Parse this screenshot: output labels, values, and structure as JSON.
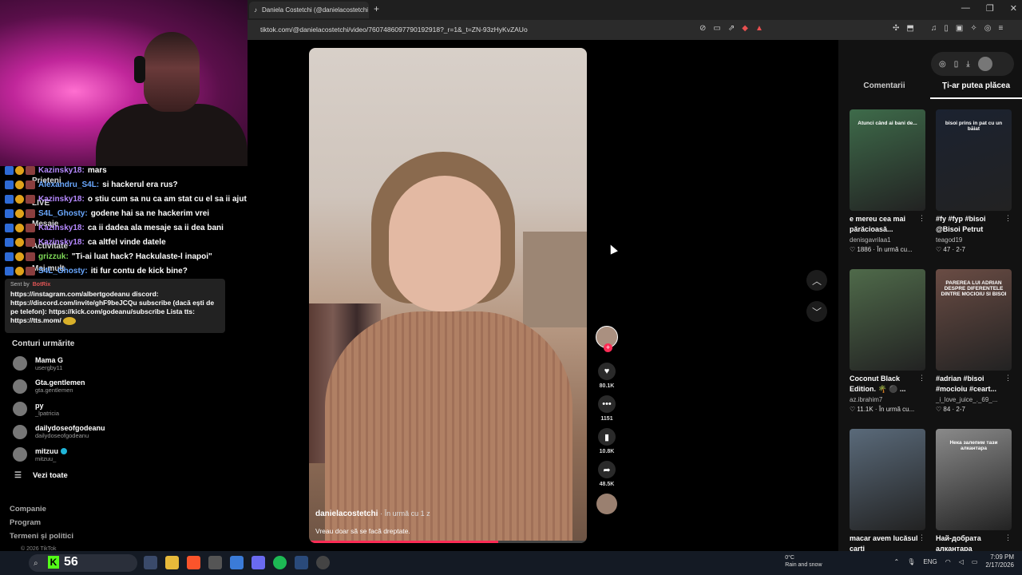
{
  "browser": {
    "tab_title": "Daniela Costetchi (@danielacostetchi",
    "tab_icon": "tiktok-icon",
    "new_tab": "+",
    "url": "tiktok.com/@danielacostetchi/video/7607486097790192918?_r=1&_t=ZN-93zHyKvZAUo",
    "window_controls": [
      "—",
      "❐",
      "✕"
    ]
  },
  "overlay_labels": {
    "friends": "Prieteni",
    "live": "LIVE",
    "activity": "Activitate",
    "messages": "Mesaje",
    "more": "Mai mult"
  },
  "chat": [
    {
      "user": "Kazinsky18:",
      "color": "#b689ff",
      "msg": "mars"
    },
    {
      "user": "Alexandru_S4L:",
      "color": "#6aa8ff",
      "msg": "si hackerul era rus?"
    },
    {
      "user": "Kazinsky18:",
      "color": "#b689ff",
      "msg": "o stiu cum sa nu ca am stat cu el sa ii ajut atunci"
    },
    {
      "user": "S4L_Ghosty:",
      "color": "#6aa8ff",
      "msg": "godene hai sa ne hackerim vrei"
    },
    {
      "user": "Kazinsky18:",
      "color": "#b689ff",
      "msg": "ca ii dadea ala mesaje sa ii dea bani"
    },
    {
      "user": "Kazinsky18:",
      "color": "#b689ff",
      "msg": "ca altfel vinde datele"
    },
    {
      "user": "grizzuk:",
      "color": "#7ed957",
      "msg": "\"Ti-ai luat hack? Hackulaste-l inapoi\""
    },
    {
      "user": "S4L_Ghosty:",
      "color": "#6aa8ff",
      "msg": "iti fur contu de kick bine?"
    }
  ],
  "tts": {
    "sent_by": "Sent by",
    "brand": "BotRix",
    "text": "https://instagram.com/albertgodeanu discord: https://discord.com/invite/ghF9beJCQu  subscribe (dacă ești de pe telefon): https://kick.com/godeanu/subscribe Lista tts: https://tts.mom/"
  },
  "followed": {
    "header": "Conturi urmărite",
    "accounts": [
      {
        "name": "Mama G",
        "user": "usergby11",
        "verified": false
      },
      {
        "name": "Gta.gentlemen",
        "user": "gta.gentlemen",
        "verified": false
      },
      {
        "name": "py",
        "user": "_lpatricia",
        "verified": false
      },
      {
        "name": "dailydoseofgodeanu",
        "user": "dailydoseofgodeanu",
        "verified": false
      },
      {
        "name": "mitzuu",
        "user": "mitzuu_",
        "verified": true
      }
    ],
    "see_all": "Vezi toate"
  },
  "footer_links": [
    "Companie",
    "Program",
    "Termeni și politici"
  ],
  "copyright": "© 2026 TikTok",
  "video": {
    "author": "danielacostetchi",
    "time": "· În urmă cu 1 z",
    "description": "Vreau doar să se facă dreptate.",
    "progress": 0.68
  },
  "actions": {
    "likes": "80.1K",
    "comments": "1151",
    "saves": "10.8K",
    "shares": "48.5K"
  },
  "right_panel": {
    "tabs": [
      "Comentarii",
      "Ți-ar putea plăcea"
    ],
    "active_tab": 1,
    "cards": [
      {
        "title": "e mereu cea mai părăcioasă...",
        "user": "denisgavrilaa1",
        "meta": "♡ 1886 · În urmă cu...",
        "thumb_text": "Atunci când ai bani de...",
        "bg": "#3e6b4a"
      },
      {
        "title": "#fy #fyp #bisoi @Bisoi Petrut",
        "user": "teagod19",
        "meta": "♡ 47 · 2-7",
        "thumb_text": "bisoi prins in pat cu un băiat",
        "bg": "#1b2230"
      },
      {
        "title": "Coconut Black Edition. 🌴 ⚫ ...",
        "user": "az.ibrahim7",
        "meta": "♡ 11.1K · În urmă cu...",
        "thumb_text": "",
        "bg": "#4f6a4a"
      },
      {
        "title": "#adrian #bisoi #mocioiu #ceart...",
        "user": "_i_love_juice_._69_...",
        "meta": "♡ 84 · 2-7",
        "thumb_text": "PAREREA LUI ADRIAN DESPRE DIFERENTELE DINTRE MOCIOIU SI BISOI",
        "bg": "#6a4c44"
      },
      {
        "title": "macar avem lucăsul carti",
        "user": "",
        "meta": "",
        "thumb_text": "",
        "bg": "#5a6a7a"
      },
      {
        "title": "Най-добрата алкантара",
        "user": "",
        "meta": "",
        "thumb_text": "Нека залепим тази алкантара",
        "bg": "#8a8a8a"
      }
    ]
  },
  "taskbar": {
    "kick_count": "56",
    "weather_temp": "0°C",
    "weather_desc": "Rain and snow",
    "lang": "ENG",
    "time": "7:09 PM",
    "date": "2/17/2026"
  },
  "colors": {
    "tiktok_red": "#fe2c55",
    "panel_bg": "#121212",
    "kick_green": "#53fc18"
  }
}
